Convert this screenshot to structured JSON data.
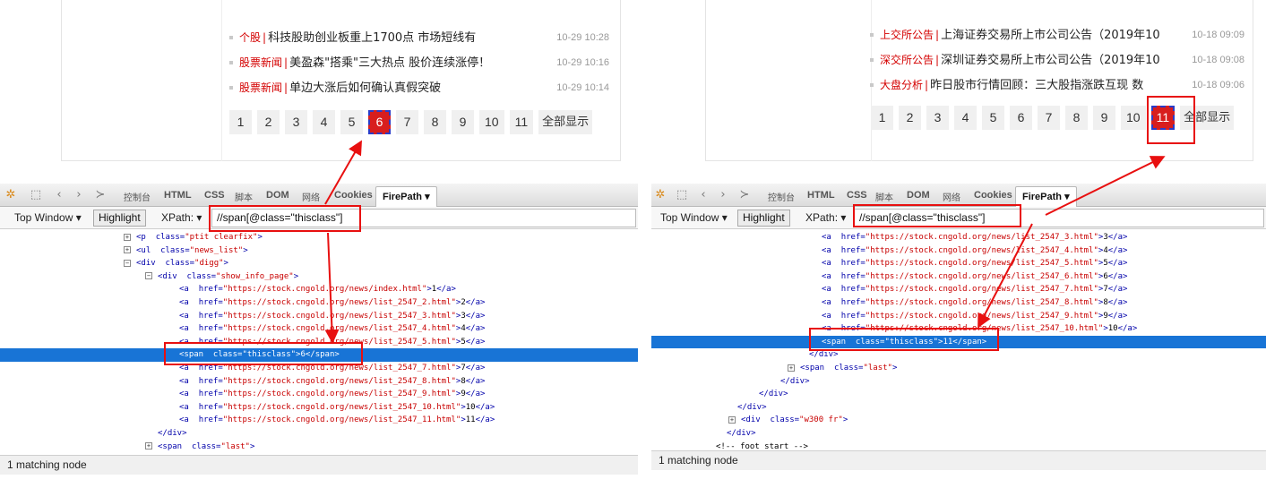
{
  "left": {
    "news": [
      {
        "category": "个股",
        "title": "科技股助创业板重上1700点 市场短线有",
        "time": "10-29 10:28"
      },
      {
        "category": "股票新闻",
        "title": "美盈森\"搭乘\"三大热点 股价连续涨停！",
        "time": "10-29 10:16"
      },
      {
        "category": "股票新闻",
        "title": "单边大涨后如何确认真假突破",
        "time": "10-29 10:14"
      }
    ],
    "pages": [
      "1",
      "2",
      "3",
      "4",
      "5",
      "6",
      "7",
      "8",
      "9",
      "10",
      "11"
    ],
    "current_page": "6",
    "show_all": "全部显示",
    "xpath": "//span[@class=\"thisclass\"]",
    "status": "1 matching node"
  },
  "right": {
    "news": [
      {
        "category": "上交所公告",
        "title": "上海证券交易所上市公司公告（2019年10",
        "time": "10-18 09:09"
      },
      {
        "category": "深交所公告",
        "title": "深圳证券交易所上市公司公告（2019年10",
        "time": "10-18 09:08"
      },
      {
        "category": "大盘分析",
        "title": "昨日股市行情回顾：三大股指涨跌互现 数",
        "time": "10-18 09:06"
      }
    ],
    "pages": [
      "1",
      "2",
      "3",
      "4",
      "5",
      "6",
      "7",
      "8",
      "9",
      "10",
      "11"
    ],
    "current_page": "11",
    "show_all": "全部显示",
    "xpath": "//span[@class=\"thisclass\"]",
    "status": "1 matching node"
  },
  "firebug": {
    "tabs": [
      "控制台",
      "HTML",
      "CSS",
      "脚本",
      "DOM",
      "网络",
      "Cookies",
      "FirePath"
    ],
    "top_window": "Top Window",
    "highlight": "Highlight",
    "xpath_label": "XPath:"
  },
  "icons": [
    "firebug-icon",
    "inspect-icon",
    "back-icon",
    "forward-icon",
    "command-icon",
    "dropdown-icon"
  ],
  "colors": {
    "accent_red": "#d81e1e",
    "selection_blue": "#1874d6",
    "annotation_red": "#e81010"
  }
}
